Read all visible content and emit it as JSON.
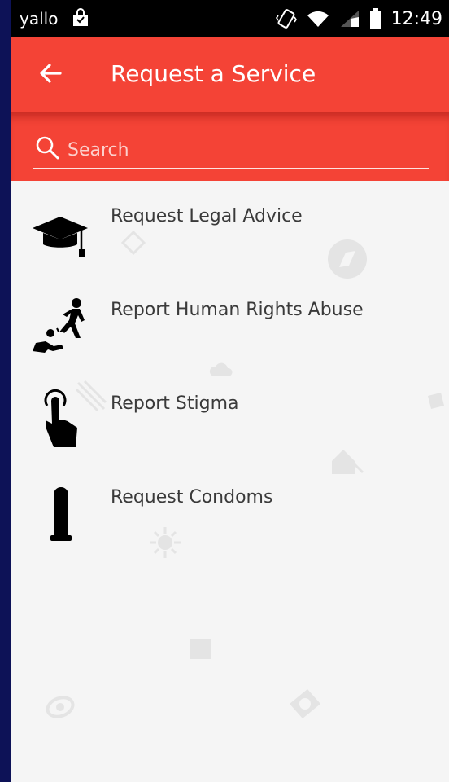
{
  "status_bar": {
    "carrier": "yallo",
    "time": "12:49"
  },
  "app_bar": {
    "title": "Request a Service",
    "back_icon": "arrow-left-icon"
  },
  "search": {
    "placeholder": "Search",
    "value": ""
  },
  "services": [
    {
      "label": "Request Legal Advice",
      "icon": "graduation-cap-icon"
    },
    {
      "label": "Report Human Rights Abuse",
      "icon": "abuse-icon"
    },
    {
      "label": "Report Stigma",
      "icon": "pointing-hand-icon"
    },
    {
      "label": "Request Condoms",
      "icon": "condom-icon"
    }
  ],
  "colors": {
    "accent": "#f44336",
    "background": "#f5f5f5",
    "frame": "#0d1257"
  }
}
